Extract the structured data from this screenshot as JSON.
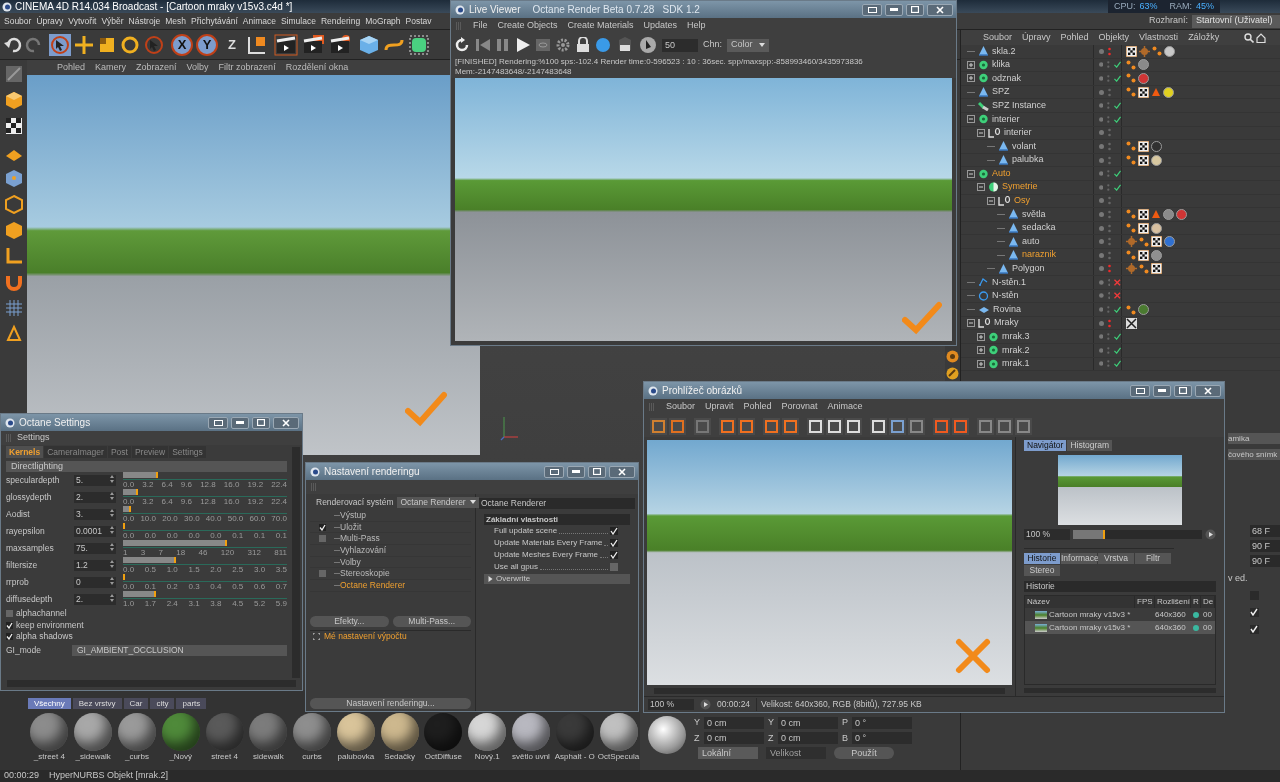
{
  "app": {
    "title": "CINEMA 4D R14.034 Broadcast - [Cartoon mraky v15v3.c4d *]",
    "menu": [
      "Soubor",
      "Úpravy",
      "Vytvořit",
      "Výběr",
      "Nástroje",
      "Mesh",
      "Přichytávání",
      "Animace",
      "Simulace",
      "Rendering",
      "MoGraph",
      "Postav"
    ],
    "axis_buttons": [
      {
        "label": "X",
        "selected": true
      },
      {
        "label": "Y",
        "selected": true
      },
      {
        "label": "Z",
        "selected": false
      }
    ],
    "monitor": {
      "cpu_label": "CPU:",
      "cpu": "63%",
      "ram_label": "RAM:",
      "ram": "45%"
    },
    "layout_label": "Rozhraní:",
    "layout_value": "Startovní (Uživatel)"
  },
  "viewport": {
    "menu": [
      "Pohled",
      "Kamery",
      "Zobrazení",
      "Volby",
      "Filtr zobrazení",
      "Rozdělení okna"
    ]
  },
  "object_manager": {
    "menu": [
      "Soubor",
      "Úpravy",
      "Pohled",
      "Objekty",
      "Vlastnosti",
      "Záložky"
    ],
    "tree": [
      {
        "name": "skla.2",
        "kind": "polygon",
        "selected": false,
        "hidden": true,
        "tags": [
          {
            "kind": "texture"
          },
          {
            "kind": "gear"
          },
          {
            "kind": "phong"
          },
          {
            "kind": "material",
            "color": "#c8c8c8"
          }
        ]
      },
      {
        "name": "klika",
        "kind": "hypernurbs",
        "expanded": false,
        "selected": false,
        "hidden": false,
        "enabled": true,
        "tags": [
          {
            "kind": "phong"
          },
          {
            "kind": "material",
            "color": "#8a8a8a"
          }
        ]
      },
      {
        "name": "odznak",
        "kind": "hypernurbs",
        "expanded": false,
        "selected": false,
        "hidden": false,
        "enabled": true,
        "tags": [
          {
            "kind": "phong"
          },
          {
            "kind": "material",
            "color": "#d03535"
          }
        ]
      },
      {
        "name": "SPZ",
        "kind": "polygon",
        "selected": false,
        "hidden": false,
        "tags": [
          {
            "kind": "phong"
          },
          {
            "kind": "texture"
          },
          {
            "kind": "cone"
          },
          {
            "kind": "material",
            "color": "#e0d020"
          }
        ]
      },
      {
        "name": "SPZ Instance",
        "kind": "instance",
        "selected": false,
        "hidden": false,
        "enabled": true
      },
      {
        "name": "interier",
        "kind": "hypernurbs",
        "expanded": true,
        "selected": false,
        "hidden": false,
        "enabled": true,
        "children": [
          {
            "name": "interier",
            "kind": "null",
            "expanded": true,
            "selected": false,
            "hidden": false,
            "children": [
              {
                "name": "volant",
                "kind": "polygon",
                "selected": false,
                "hidden": false,
                "tags": [
                  {
                    "kind": "phong"
                  },
                  {
                    "kind": "texture"
                  },
                  {
                    "kind": "material",
                    "color": "#303030"
                  }
                ]
              },
              {
                "name": "palubka",
                "kind": "polygon",
                "selected": false,
                "hidden": false,
                "tags": [
                  {
                    "kind": "phong"
                  },
                  {
                    "kind": "texture"
                  },
                  {
                    "kind": "material",
                    "color": "#d8c8a0"
                  }
                ]
              }
            ]
          }
        ]
      },
      {
        "name": "Auto",
        "kind": "hypernurbs",
        "expanded": true,
        "selected": true,
        "hidden": false,
        "enabled": true,
        "children": [
          {
            "name": "Symetrie",
            "kind": "symmetry",
            "expanded": true,
            "selected": true,
            "hidden": false,
            "enabled": true,
            "children": [
              {
                "name": "Osy",
                "kind": "null",
                "expanded": true,
                "selected": true,
                "hidden": false,
                "children": [
                  {
                    "name": "světla",
                    "kind": "polygon",
                    "selected": false,
                    "hidden": false,
                    "tags": [
                      {
                        "kind": "phong"
                      },
                      {
                        "kind": "texture"
                      },
                      {
                        "kind": "cone"
                      },
                      {
                        "kind": "material",
                        "color": "#8a8a8a"
                      },
                      {
                        "kind": "material",
                        "color": "#d03535"
                      }
                    ]
                  },
                  {
                    "name": "sedacka",
                    "kind": "polygon",
                    "selected": false,
                    "hidden": false,
                    "tags": [
                      {
                        "kind": "phong"
                      },
                      {
                        "kind": "texture"
                      },
                      {
                        "kind": "material",
                        "color": "#d8c0a0"
                      }
                    ]
                  },
                  {
                    "name": "auto",
                    "kind": "polygon",
                    "selected": false,
                    "hidden": false,
                    "tags": [
                      {
                        "kind": "gear"
                      },
                      {
                        "kind": "phong"
                      },
                      {
                        "kind": "texture"
                      },
                      {
                        "kind": "material",
                        "color": "#3070d0"
                      }
                    ]
                  },
                  {
                    "name": "naraznik",
                    "kind": "polygon",
                    "selected": true,
                    "hidden": false,
                    "tags": [
                      {
                        "kind": "phong"
                      },
                      {
                        "kind": "texture"
                      },
                      {
                        "kind": "material",
                        "color": "#909090"
                      }
                    ]
                  }
                ]
              },
              {
                "name": "Polygon",
                "kind": "polygon",
                "selected": false,
                "hidden": true,
                "tags": [
                  {
                    "kind": "gear"
                  },
                  {
                    "kind": "phong"
                  },
                  {
                    "kind": "texture"
                  }
                ]
              }
            ]
          }
        ]
      },
      {
        "name": "N-stěn.1",
        "kind": "spline_star",
        "selected": false,
        "hidden": false,
        "enabled": false
      },
      {
        "name": "N-stěn",
        "kind": "spline_circle",
        "selected": false,
        "hidden": false,
        "enabled": false
      },
      {
        "name": "Rovina",
        "kind": "plane",
        "selected": false,
        "hidden": false,
        "enabled": true,
        "tags": [
          {
            "kind": "phong"
          },
          {
            "kind": "material",
            "color": "#4a7a30"
          }
        ]
      },
      {
        "name": "Mraky",
        "kind": "null",
        "expanded": true,
        "selected": false,
        "hidden": true,
        "tags": [
          {
            "kind": "display"
          }
        ],
        "children": [
          {
            "name": "mrak.3",
            "kind": "hypernurbs",
            "expanded": false,
            "selected": false,
            "hidden": false,
            "enabled": true
          },
          {
            "name": "mrak.2",
            "kind": "hypernurbs",
            "expanded": false,
            "selected": false,
            "hidden": false,
            "enabled": true
          },
          {
            "name": "mrak.1",
            "kind": "hypernurbs",
            "expanded": false,
            "selected": false,
            "hidden": false,
            "enabled": true
          }
        ]
      }
    ]
  },
  "attributes": {
    "labels": [
      "amika",
      "čového snímk"
    ],
    "frames": [
      "68 F",
      "90 F",
      "90 F"
    ],
    "option_label": "v ed.",
    "checks": [
      {
        "checked": false
      },
      {
        "checked": true
      },
      {
        "checked": true
      }
    ]
  },
  "materials": {
    "tabs": [
      {
        "label": "Všechny",
        "selected": true
      },
      {
        "label": "Bez vrstvy",
        "selected": false
      },
      {
        "label": "Car",
        "selected": false
      },
      {
        "label": "city",
        "selected": false
      },
      {
        "label": "parts",
        "selected": false
      }
    ],
    "items": [
      {
        "name": "_street 4",
        "color": "#8c8c8c"
      },
      {
        "name": "_sidewalk",
        "color": "#a8a8a8"
      },
      {
        "name": "_curbs",
        "color": "#9a9a9a"
      },
      {
        "name": "_Nový",
        "color": "#4f8a3a"
      },
      {
        "name": "street 4",
        "color": "#5a5a5a"
      },
      {
        "name": "sidewalk",
        "color": "#7c7c7c"
      },
      {
        "name": "curbs",
        "color": "#8e8e8e"
      },
      {
        "name": "palubovka",
        "color": "#d9c49a"
      },
      {
        "name": "Sedačky",
        "color": "#cdb88e"
      },
      {
        "name": "OctDiffuse",
        "color": "#1e1e1e"
      },
      {
        "name": "Nový.1",
        "color": "#d6d6d6"
      },
      {
        "name": "světlo uvnl",
        "color": "#b8b8c0"
      },
      {
        "name": "Asphalt - O",
        "color": "#3a3a3a"
      },
      {
        "name": "OctSpecula",
        "color": "#c0c0c0"
      }
    ]
  },
  "coordinates": {
    "rows": [
      [
        {
          "axis": "Y",
          "value": "0 cm"
        },
        {
          "axis": "Y",
          "value": "0 cm"
        },
        {
          "axis": "P",
          "value": "0 °"
        }
      ],
      [
        {
          "axis": "Z",
          "value": "0 cm"
        },
        {
          "axis": "Z",
          "value": "0 cm"
        },
        {
          "axis": "B",
          "value": "0 °"
        }
      ]
    ],
    "mode": "Lokální",
    "size_mode": "Velikost",
    "size_disabled": true,
    "apply": "Použít"
  },
  "status_bar": {
    "time": "00:00:29",
    "message": "HyperNURBS Objekt [mrak.2]"
  },
  "live_viewer": {
    "title": "Live Viewer",
    "subtitle": "Octane Render Beta 0.7.28   SDK 1.2",
    "menu": [
      "File",
      "Create Objects",
      "Create Materials",
      "Updates",
      "Help"
    ],
    "samples": "50",
    "channel_label": "Chn:",
    "channel": "Color",
    "status": "[FINISHED]  Rendering:%100 sps:-102.4 Render time:0-596523 : 10 : 36sec. spp/maxspp:-858993460/3435973836 Mem:-2147483648/-2147483648"
  },
  "octane_settings": {
    "title": "Octane Settings",
    "section": "Settings",
    "tabs": [
      {
        "label": "Kernels",
        "selected": true
      },
      {
        "label": "CameraImager",
        "selected": false
      },
      {
        "label": "Post",
        "selected": false
      },
      {
        "label": "Preview",
        "selected": false
      },
      {
        "label": "Settings",
        "selected": false
      }
    ],
    "group": "Directlighting",
    "params": [
      {
        "label": "speculardepth",
        "value": "5.",
        "level": 0.2,
        "ticks": [
          "0.0",
          "3.2",
          "6.4",
          "9.6",
          "12.8",
          "16.0",
          "19.2",
          "22.4"
        ]
      },
      {
        "label": "glossydepth",
        "value": "2.",
        "level": 0.08,
        "ticks": [
          "0.0",
          "3.2",
          "6.4",
          "9.6",
          "12.8",
          "16.0",
          "19.2",
          "22.4"
        ]
      },
      {
        "label": "Aodist",
        "value": "3.",
        "level": 0.035,
        "ticks": [
          "0.0",
          "10.0",
          "20.0",
          "30.0",
          "40.0",
          "50.0",
          "60.0",
          "70.0"
        ]
      },
      {
        "label": "rayepsilon",
        "value": "0.0001",
        "level": 0.0,
        "ticks": [
          "0.0",
          "0.0",
          "0.0",
          "0.0",
          "0.0",
          "0.1",
          "0.1",
          "0.1"
        ]
      },
      {
        "label": "maxsamples",
        "value": "75.",
        "level": 0.62,
        "ticks": [
          "1",
          "3",
          "7",
          "18",
          "46",
          "120",
          "312",
          "811"
        ]
      },
      {
        "label": "filtersize",
        "value": "1.2",
        "level": 0.31,
        "ticks": [
          "0.0",
          "0.5",
          "1.0",
          "1.5",
          "2.0",
          "2.5",
          "3.0",
          "3.5"
        ]
      },
      {
        "label": "rrprob",
        "value": "0",
        "level": 0.0,
        "ticks": [
          "0.0",
          "0.1",
          "0.2",
          "0.3",
          "0.4",
          "0.5",
          "0.6",
          "0.7"
        ]
      },
      {
        "label": "diffusedepth",
        "value": "2.",
        "level": 0.19,
        "ticks": [
          "1.0",
          "1.7",
          "2.4",
          "3.1",
          "3.8",
          "4.5",
          "5.2",
          "5.9"
        ]
      }
    ],
    "checkboxes": [
      {
        "label": "alphachannel",
        "checked": false
      },
      {
        "label": "keep environment",
        "checked": true
      },
      {
        "label": "alpha shadows",
        "checked": true
      }
    ],
    "gi_label": "GI_mode",
    "gi_value": "GI_AMBIENT_OCCLUSION"
  },
  "render_settings": {
    "title": "Nastavení renderingu",
    "renderer_label": "Renderovací systém",
    "renderer": "Octane Renderer",
    "items": [
      {
        "label": "Výstup",
        "kind": "plain",
        "selected": false
      },
      {
        "label": "Uložit",
        "kind": "checkbox",
        "checked": true,
        "selected": false
      },
      {
        "label": "Multi-Pass",
        "kind": "checkbox",
        "checked": false,
        "selected": false
      },
      {
        "label": "Vyhlazování",
        "kind": "plain",
        "selected": false
      },
      {
        "label": "Volby",
        "kind": "plain",
        "selected": false
      },
      {
        "label": "Stereoskopie",
        "kind": "checkbox",
        "checked": false,
        "selected": false
      },
      {
        "label": "Octane Renderer",
        "kind": "plain",
        "selected": true
      }
    ],
    "buttons": [
      "Efekty...",
      "Multi-Pass..."
    ],
    "presets": [
      "Mé nastavení výpočtu"
    ],
    "bottom_button": "Nastavení renderingu...",
    "panel_title": "Octane Renderer",
    "group": "Základní vlastnosti",
    "options": [
      {
        "label": "Full update scene",
        "checked": true
      },
      {
        "label": "Update Materials Every Frame",
        "checked": true
      },
      {
        "label": "Update Meshes Every Frame",
        "checked": true
      },
      {
        "label": "Use all gpus",
        "checked": false
      }
    ],
    "overwrite": {
      "label": "Overwrite",
      "expanded": false
    }
  },
  "picture_viewer": {
    "title": "Prohlížeč obrázků",
    "menu": [
      "Soubor",
      "Upravit",
      "Pohled",
      "Porovnat",
      "Animace"
    ],
    "nav_tabs": [
      {
        "label": "Navigátor",
        "selected": true
      },
      {
        "label": "Histogram",
        "selected": false
      }
    ],
    "zoom": "100 %",
    "zoom_slider": {
      "level": 0.25
    },
    "info_tabs": [
      {
        "label": "Historie",
        "selected": true
      },
      {
        "label": "Informace",
        "selected": false
      },
      {
        "label": "Vrstva",
        "selected": false
      },
      {
        "label": "Filtr",
        "selected": false
      },
      {
        "label": "Stereo",
        "selected": false
      }
    ],
    "history_title": "Historie",
    "columns": [
      "Název",
      "FPS",
      "Rozlišení",
      "R",
      "De"
    ],
    "rows": [
      {
        "name": "Cartoon mraky v15v3 *",
        "resolution": "640x360",
        "color": "#3ab8a0",
        "time": "00",
        "selected": false
      },
      {
        "name": "Cartoon mraky v15v3 *",
        "resolution": "640x360",
        "color": "#3ab8a0",
        "time": "00",
        "selected": true
      }
    ],
    "status_zoom": "100 %",
    "status_time": "00:00:24",
    "status_info": "Velikost: 640x360, RGB (8bitů), 727.95 KB"
  }
}
